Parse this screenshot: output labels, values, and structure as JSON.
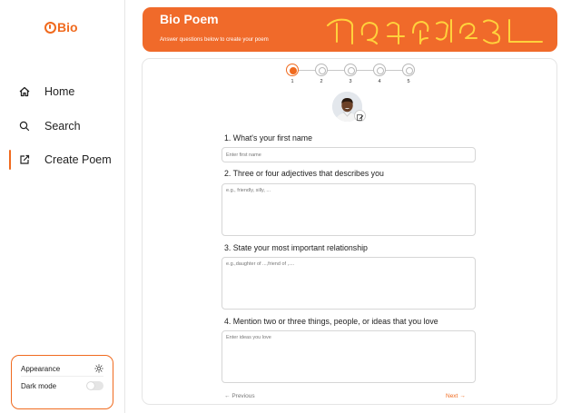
{
  "app": {
    "logo_text": "Bio"
  },
  "sidebar": {
    "items": [
      {
        "label": "Home",
        "icon": "home-icon"
      },
      {
        "label": "Search",
        "icon": "search-icon"
      },
      {
        "label": "Create Poem",
        "icon": "create-icon",
        "active": true
      }
    ],
    "settings": {
      "appearance_label": "Appearance",
      "appearance_icon": "sun-icon",
      "dark_mode_label": "Dark mode",
      "dark_mode_on": false
    }
  },
  "banner": {
    "title": "Bio Poem",
    "subtitle": "Answer questions below to create your poem"
  },
  "stepper": {
    "steps": [
      "1",
      "2",
      "3",
      "4",
      "5"
    ],
    "current": 1
  },
  "questions": [
    {
      "label": "1. What's your first name",
      "placeholder": "Enter first name"
    },
    {
      "label": "2. Three or four adjectives that describes you",
      "placeholder": "e.g., friendly, silly, ..."
    },
    {
      "label": "3. State your most important relationship",
      "placeholder": "e.g.,daughter of ...,friend of ,...."
    },
    {
      "label": "4. Mention two or three things, people, or ideas that you love",
      "placeholder": "Enter ideas you love"
    }
  ],
  "navigation": {
    "previous_label": "Previous",
    "next_label": "Next"
  },
  "colors": {
    "accent": "#f06a1e",
    "banner": "#f06a2a",
    "banner_decoration": "#ffd23c"
  }
}
